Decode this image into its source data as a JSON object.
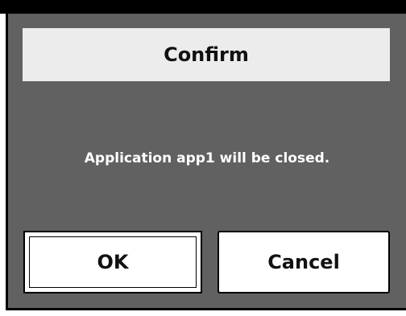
{
  "dialog": {
    "title": "Confirm",
    "message": "Application app1 will be closed.",
    "ok_label": "OK",
    "cancel_label": "Cancel"
  },
  "colors": {
    "dialog_background": "#616161",
    "title_background": "#ececec",
    "button_background": "#ffffff",
    "text_dark": "#111111",
    "text_light": "#ffffff"
  }
}
